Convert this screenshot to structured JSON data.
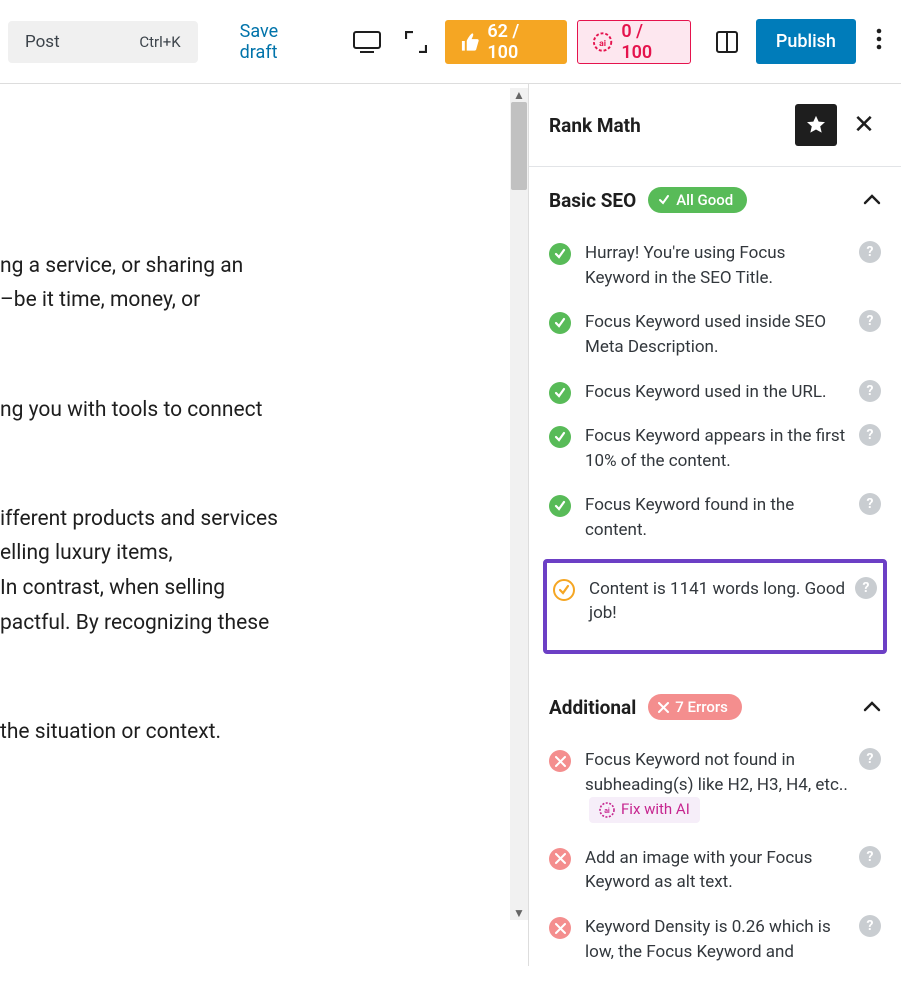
{
  "toolbar": {
    "post_label": "Post",
    "post_shortcut": "Ctrl+K",
    "save_draft": "Save draft",
    "score1": "62 / 100",
    "score2": "0 / 100",
    "publish": "Publish"
  },
  "editor": {
    "p1": "ng a service, or sharing an\n–be it time, money, or",
    "p2": "ng you with tools to connect",
    "p3": "ifferent products and services\nelling luxury items,\n In contrast, when selling\npactful. By recognizing these",
    "p4": " the situation or context."
  },
  "sidebar": {
    "title": "Rank Math",
    "basic": {
      "heading": "Basic SEO",
      "status": "All Good",
      "items": [
        "Hurray! You're using Focus Keyword in the SEO Title.",
        "Focus Keyword used inside SEO Meta Description.",
        "Focus Keyword used in the URL.",
        "Focus Keyword appears in the first 10% of the content.",
        "Focus Keyword found in the content.",
        "Content is 1141 words long. Good job!"
      ]
    },
    "additional": {
      "heading": "Additional",
      "status": "7 Errors",
      "items": [
        "Focus Keyword not found in subheading(s) like H2, H3, H4, etc.. ",
        "Add an image with your Focus Keyword as alt text.",
        "Keyword Density is 0.26 which is low, the Focus Keyword and"
      ],
      "fix_ai": "Fix with AI"
    }
  }
}
